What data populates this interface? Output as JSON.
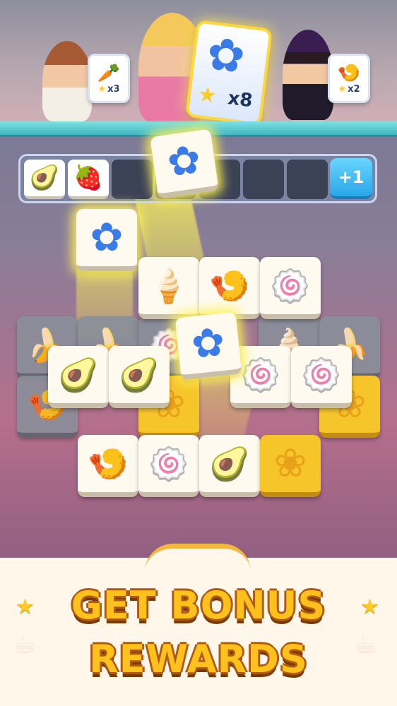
{
  "goals": {
    "left": {
      "icon": "carrot",
      "count": "x3"
    },
    "center": {
      "icon": "blue-flower",
      "count": "x8"
    },
    "right": {
      "icon": "shrimp",
      "count": "x2"
    }
  },
  "tray": {
    "slots": [
      "🥑",
      "🍓",
      "",
      "",
      "",
      "",
      ""
    ],
    "bonus_label": "+1"
  },
  "board": {
    "tiles": [
      {
        "name": "ice-cream",
        "glyph": "🍦"
      },
      {
        "name": "shrimp",
        "glyph": "🍤"
      },
      {
        "name": "swiss-roll",
        "glyph": "🍥"
      },
      {
        "name": "banana",
        "glyph": "🍌"
      },
      {
        "name": "avocado",
        "glyph": "🥑"
      },
      {
        "name": "blue-flower",
        "glyph": "✿"
      },
      {
        "name": "yellow-flower",
        "glyph": "❀"
      }
    ]
  },
  "banner": {
    "line1": "GET BONUS",
    "line2": "REWARDS"
  },
  "colors": {
    "accent": "#ffc21c",
    "outline": "#b05a10",
    "shelf": "#3fb7c2",
    "bonus_button": "#2aa6e8"
  }
}
